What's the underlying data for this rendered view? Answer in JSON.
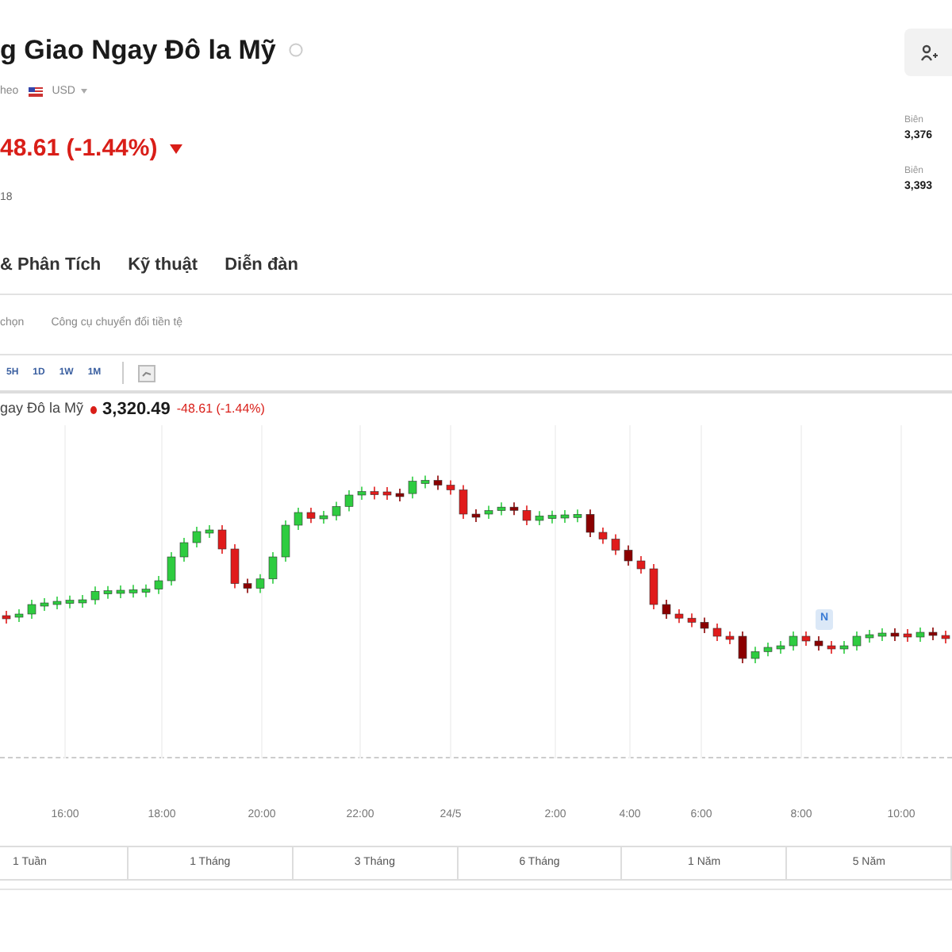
{
  "header": {
    "title": "g Giao Ngay Đô la Mỹ",
    "subtitle": "heo",
    "currency": "USD",
    "price_change": "48.61 (-1.44%)",
    "down": true,
    "time": "18"
  },
  "stats": [
    {
      "label": "Biên",
      "value": "3,376"
    },
    {
      "label": "Biên",
      "value": "3,393"
    }
  ],
  "tabs": [
    "& Phân Tích",
    "Kỹ thuật",
    "Diễn đàn"
  ],
  "sub_links": [
    "chọn",
    "Công cụ chuyển đổi tiền tệ"
  ],
  "intervals": [
    "5H",
    "1D",
    "1W",
    "1M"
  ],
  "legend": {
    "name": "gay Đô la Mỹ",
    "price": "3,320.49",
    "change": "-48.61 (-1.44%)"
  },
  "marker": "N",
  "x_axis": [
    "16:00",
    "18:00",
    "20:00",
    "22:00",
    "24/5",
    "2:00",
    "4:00",
    "6:00",
    "8:00",
    "10:00"
  ],
  "ranges": [
    "1 Tuần",
    "1 Tháng",
    "3 Tháng",
    "6 Tháng",
    "1 Năm",
    "5 Năm"
  ]
}
